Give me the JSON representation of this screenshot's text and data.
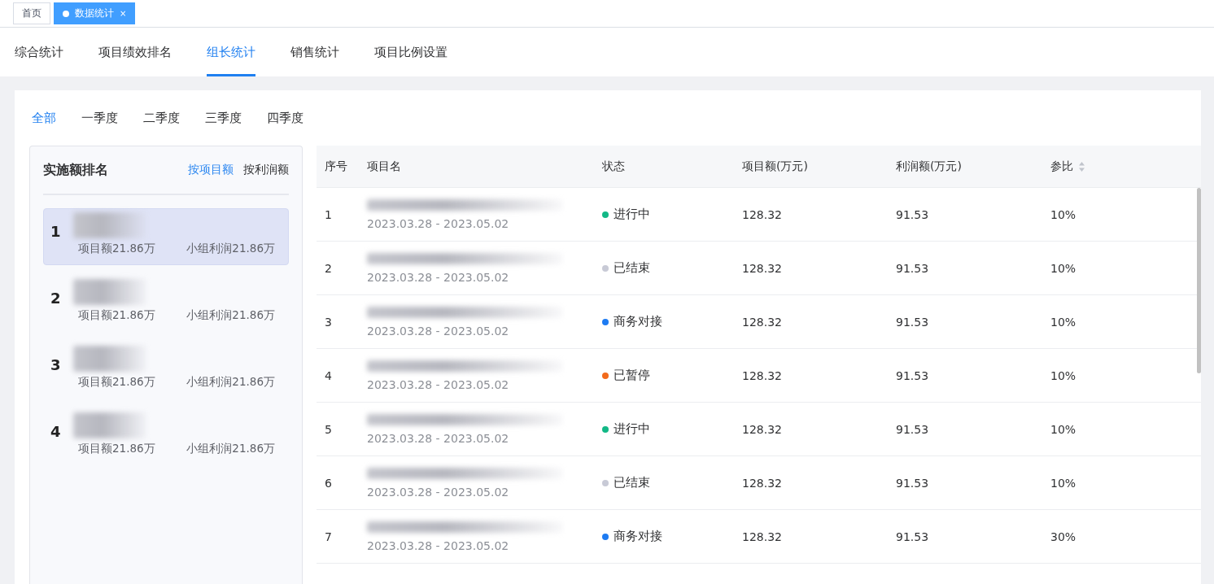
{
  "page_tabs": [
    {
      "label": "首页",
      "selected": false
    },
    {
      "label": "数据统计",
      "selected": true,
      "close": "×"
    }
  ],
  "tabs": [
    {
      "label": "综合统计",
      "selected": false
    },
    {
      "label": "项目绩效排名",
      "selected": false
    },
    {
      "label": "组长统计",
      "selected": true
    },
    {
      "label": "销售统计",
      "selected": false
    },
    {
      "label": "项目比例设置",
      "selected": false
    }
  ],
  "periods": [
    {
      "label": "全部",
      "selected": true
    },
    {
      "label": "一季度",
      "selected": false
    },
    {
      "label": "二季度",
      "selected": false
    },
    {
      "label": "三季度",
      "selected": false
    },
    {
      "label": "四季度",
      "selected": false
    }
  ],
  "ranking": {
    "title": "实施额排名",
    "sorts": [
      {
        "label": "按项目额",
        "selected": true
      },
      {
        "label": "按利润额",
        "selected": false
      }
    ],
    "items": [
      {
        "rank": "1",
        "amount": "项目额21.86万",
        "profit": "小组利润21.86万",
        "selected": true
      },
      {
        "rank": "2",
        "amount": "项目额21.86万",
        "profit": "小组利润21.86万",
        "selected": false
      },
      {
        "rank": "3",
        "amount": "项目额21.86万",
        "profit": "小组利润21.86万",
        "selected": false
      },
      {
        "rank": "4",
        "amount": "项目额21.86万",
        "profit": "小组利润21.86万",
        "selected": false
      }
    ]
  },
  "table": {
    "columns": [
      "序号",
      "项目名",
      "状态",
      "项目额(万元)",
      "利润额(万元)",
      "参比"
    ],
    "rows": [
      {
        "no": "1",
        "dates": "2023.03.28 - 2023.05.02",
        "status": "进行中",
        "color": "#12b886",
        "amount": "128.32",
        "profit": "91.53",
        "ratio": "10%"
      },
      {
        "no": "2",
        "dates": "2023.03.28 - 2023.05.02",
        "status": "已结束",
        "color": "#c8cad6",
        "amount": "128.32",
        "profit": "91.53",
        "ratio": "10%"
      },
      {
        "no": "3",
        "dates": "2023.03.28 - 2023.05.02",
        "status": "商务对接",
        "color": "#1d7bf2",
        "amount": "128.32",
        "profit": "91.53",
        "ratio": "10%"
      },
      {
        "no": "4",
        "dates": "2023.03.28 - 2023.05.02",
        "status": "已暂停",
        "color": "#f26a1b",
        "amount": "128.32",
        "profit": "91.53",
        "ratio": "10%"
      },
      {
        "no": "5",
        "dates": "2023.03.28 - 2023.05.02",
        "status": "进行中",
        "color": "#12b886",
        "amount": "128.32",
        "profit": "91.53",
        "ratio": "10%"
      },
      {
        "no": "6",
        "dates": "2023.03.28 - 2023.05.02",
        "status": "已结束",
        "color": "#c8cad6",
        "amount": "128.32",
        "profit": "91.53",
        "ratio": "10%"
      },
      {
        "no": "7",
        "dates": "2023.03.28 - 2023.05.02",
        "status": "商务对接",
        "color": "#1d7bf2",
        "amount": "128.32",
        "profit": "91.53",
        "ratio": "30%"
      }
    ]
  }
}
